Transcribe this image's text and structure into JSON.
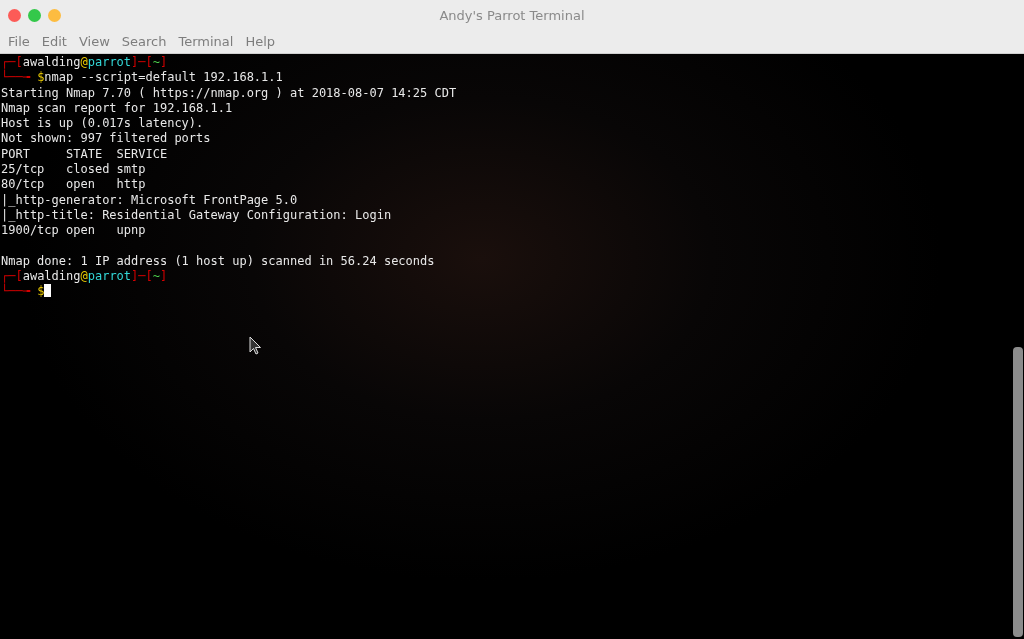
{
  "window": {
    "title": "Andy's Parrot Terminal"
  },
  "menu": [
    "File",
    "Edit",
    "View",
    "Search",
    "Terminal",
    "Help"
  ],
  "terminal": {
    "lines": [
      {
        "kind": "prompt",
        "segments": [
          {
            "kind": "frame",
            "text": "┌─["
          },
          {
            "kind": "user",
            "text": "awalding"
          },
          {
            "kind": "at",
            "text": "@"
          },
          {
            "kind": "host",
            "text": "parrot"
          },
          {
            "kind": "frame",
            "text": "]─["
          },
          {
            "kind": "dir",
            "text": "~"
          },
          {
            "kind": "frame",
            "text": "]"
          }
        ]
      },
      {
        "kind": "command",
        "segments": [
          {
            "kind": "frame",
            "text": "└──╼ "
          },
          {
            "kind": "symbol",
            "text": "$"
          },
          {
            "kind": "plain",
            "text": "nmap --script=default 192.168.1.1"
          }
        ],
        "cursor": false
      },
      {
        "kind": "output",
        "text": "Starting Nmap 7.70 ( https://nmap.org ) at 2018-08-07 14:25 CDT"
      },
      {
        "kind": "output",
        "text": "Nmap scan report for 192.168.1.1"
      },
      {
        "kind": "output",
        "text": "Host is up (0.017s latency)."
      },
      {
        "kind": "output",
        "text": "Not shown: 997 filtered ports"
      },
      {
        "kind": "output",
        "text": "PORT     STATE  SERVICE"
      },
      {
        "kind": "output",
        "text": "25/tcp   closed smtp"
      },
      {
        "kind": "output",
        "text": "80/tcp   open   http"
      },
      {
        "kind": "output",
        "text": "|_http-generator: Microsoft FrontPage 5.0"
      },
      {
        "kind": "output",
        "text": "|_http-title: Residential Gateway Configuration: Login"
      },
      {
        "kind": "output",
        "text": "1900/tcp open   upnp"
      },
      {
        "kind": "blank"
      },
      {
        "kind": "output",
        "text": "Nmap done: 1 IP address (1 host up) scanned in 56.24 seconds"
      },
      {
        "kind": "prompt",
        "segments": [
          {
            "kind": "frame",
            "text": "┌─["
          },
          {
            "kind": "user",
            "text": "awalding"
          },
          {
            "kind": "at",
            "text": "@"
          },
          {
            "kind": "host",
            "text": "parrot"
          },
          {
            "kind": "frame",
            "text": "]─["
          },
          {
            "kind": "dir",
            "text": "~"
          },
          {
            "kind": "frame",
            "text": "]"
          }
        ]
      },
      {
        "kind": "command",
        "segments": [
          {
            "kind": "frame",
            "text": "└──╼ "
          },
          {
            "kind": "symbol",
            "text": "$"
          }
        ],
        "cursor": true
      }
    ]
  }
}
